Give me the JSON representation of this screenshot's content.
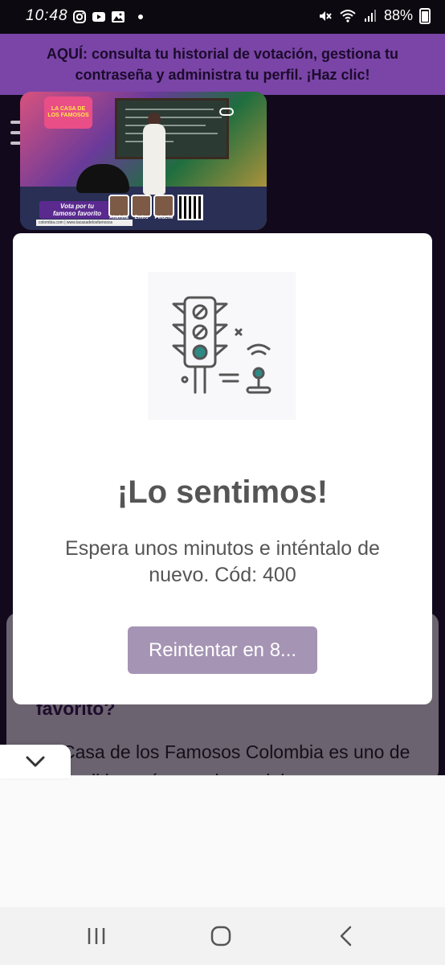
{
  "status_bar": {
    "time": "10:48",
    "battery": "88%",
    "left_icons": [
      "instagram-icon",
      "youtube-icon",
      "gallery-icon",
      "dot-icon"
    ],
    "right_icons": [
      "mute-icon",
      "wifi-icon",
      "signal-icon",
      "battery-icon"
    ]
  },
  "banner": {
    "text": "AQUÍ: consulta tu historial de votación, gestiona tu contraseña y administra tu perfil. ¡Haz clic!",
    "color": "#7a45a7"
  },
  "video": {
    "logo_text": "LA CASA DE LOS FAMOSOS",
    "vote_line1": "Vota por tu",
    "vote_line2": "famoso favorito",
    "url_text": "colombia.com | www.lacasadelosfamosos",
    "contestants": [
      "Altafulla",
      "Emiro",
      "Peluche"
    ]
  },
  "modal": {
    "title": "¡Lo sentimos!",
    "message": "Espera unos minutos e inténtalo de nuevo. Cód: 400",
    "retry_label": "Reintentar en 8...",
    "button_color": "#a594b4",
    "illustration": "traffic-light-icon"
  },
  "article": {
    "heading": "favorito?",
    "body": "La Casa de los Famosos Colombia es uno de los realities más populares del"
  },
  "nav": {
    "recent_icon": "recent-apps-icon",
    "home_icon": "home-icon",
    "back_icon": "back-icon"
  }
}
